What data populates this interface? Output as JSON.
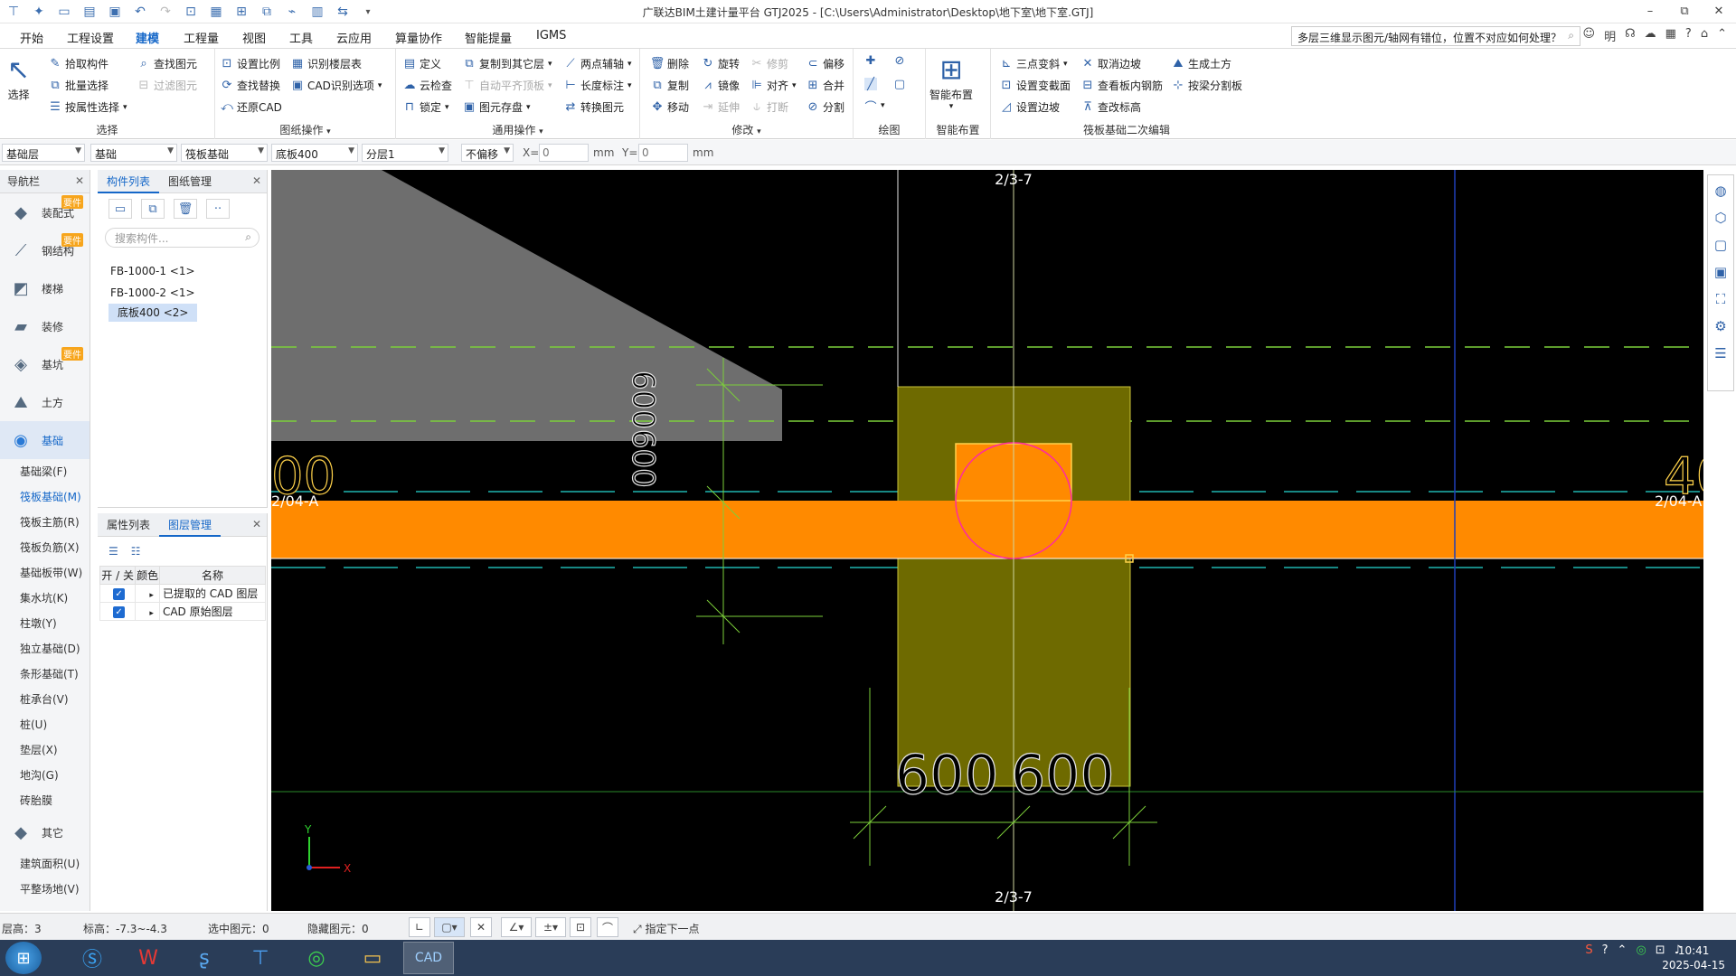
{
  "window": {
    "title": "广联达BIM土建计量平台 GTJ2025 - [C:\\Users\\Administrator\\Desktop\\地下室\\地下室.GTJ]",
    "controls": [
      "–",
      "⧉",
      "✕"
    ]
  },
  "menu": {
    "tabs": [
      "开始",
      "工程设置",
      "建模",
      "工程量",
      "视图",
      "工具",
      "云应用",
      "算量协作",
      "智能提量",
      "IGMS"
    ],
    "active": "建模",
    "help_query": "多层三维显示图元/轴网有错位，位置不对应如何处理？",
    "user_label": "明"
  },
  "ribbon": {
    "select": {
      "label": "选择",
      "big": "选择",
      "items": [
        "拾取构件",
        "批量选择",
        "按属性选择",
        "查找图元",
        "过滤图元"
      ]
    },
    "drawing_ops": {
      "label": "图纸操作",
      "items": [
        "设置比例",
        "查找替换",
        "还原CAD",
        "识别楼层表",
        "CAD识别选项"
      ]
    },
    "general_ops": {
      "label": "通用操作",
      "items": [
        "定义",
        "云检查",
        "锁定",
        "复制到其它层",
        "自动平齐顶板",
        "图元存盘",
        "两点辅轴",
        "长度标注",
        "转换图元"
      ]
    },
    "modify": {
      "label": "修改",
      "items": [
        "删除",
        "复制",
        "移动",
        "旋转",
        "镜像",
        "延伸",
        "修剪",
        "对齐",
        "打断",
        "偏移",
        "合并",
        "分割"
      ]
    },
    "draw": {
      "label": "绘图"
    },
    "smart": {
      "label": "智能布置",
      "big": "智能布置"
    },
    "raft_edit": {
      "label": "筏板基础二次编辑",
      "items": [
        "三点变斜",
        "设置变截面",
        "设置边坡",
        "取消边坡",
        "查看板内钢筋",
        "查改标高",
        "生成土方",
        "按梁分割板"
      ]
    }
  },
  "propbar": {
    "floor": "基础层",
    "type": "基础",
    "subtype": "筏板基础",
    "component": "底板400",
    "layer": "分层1",
    "offset": "不偏移",
    "x_label": "X=",
    "x_value": "0",
    "y_label": "Y=",
    "y_value": "0",
    "unit": "mm"
  },
  "nav": {
    "title": "导航栏",
    "categories": [
      {
        "label": "装配式",
        "badge": "要件"
      },
      {
        "label": "钢结构",
        "badge": "要件"
      },
      {
        "label": "楼梯",
        "badge": ""
      },
      {
        "label": "装修",
        "badge": ""
      },
      {
        "label": "基坑",
        "badge": "要件"
      },
      {
        "label": "土方",
        "badge": ""
      },
      {
        "label": "基础",
        "badge": ""
      }
    ],
    "sub_items": [
      "基础梁(F)",
      "筏板基础(M)",
      "筏板主筋(R)",
      "筏板负筋(X)",
      "基础板带(W)",
      "集水坑(K)",
      "柱墩(Y)",
      "独立基础(D)",
      "条形基础(T)",
      "桩承台(V)",
      "桩(U)",
      "垫层(X)",
      "地沟(G)",
      "砖胎膜"
    ],
    "other": "其它",
    "other_items": [
      "建筑面积(U)",
      "平整场地(V)"
    ]
  },
  "components": {
    "tabs": [
      "构件列表",
      "图纸管理"
    ],
    "search_placeholder": "搜索构件...",
    "items": [
      "FB-1000-1 <1>",
      "FB-1000-2 <1>",
      "底板400 <2>"
    ]
  },
  "layers": {
    "tabs": [
      "属性列表",
      "图层管理"
    ],
    "headers": [
      "开 / 关",
      "颜色",
      "名称"
    ],
    "rows": [
      {
        "name": "已提取的 CAD 图层"
      },
      {
        "name": "CAD 原始图层"
      }
    ]
  },
  "canvas": {
    "axis_top": "2/3-7",
    "axis_bottom": "2/3-7",
    "axis_left": "2/04-A",
    "axis_right": "2/04-A",
    "dim1": "600",
    "dim2": "600",
    "left_dim": "600600",
    "left_cut": "00",
    "right_cut": "40",
    "y_axis": "Y",
    "x_axis": "X"
  },
  "status": {
    "floor_height": "层高：3",
    "elevation": "标高：-7.3~-4.3",
    "selected": "选中图元：0",
    "hidden": "隐藏图元：0",
    "hint": "指定下一点"
  },
  "taskbar": {
    "time": "10:41",
    "date": "2025-04-15"
  },
  "colors": {
    "canvas_bg": "#000000",
    "slab_orange": "#ff8a00",
    "pier_olive": "#6e6a00",
    "accent": "#1567c8"
  }
}
